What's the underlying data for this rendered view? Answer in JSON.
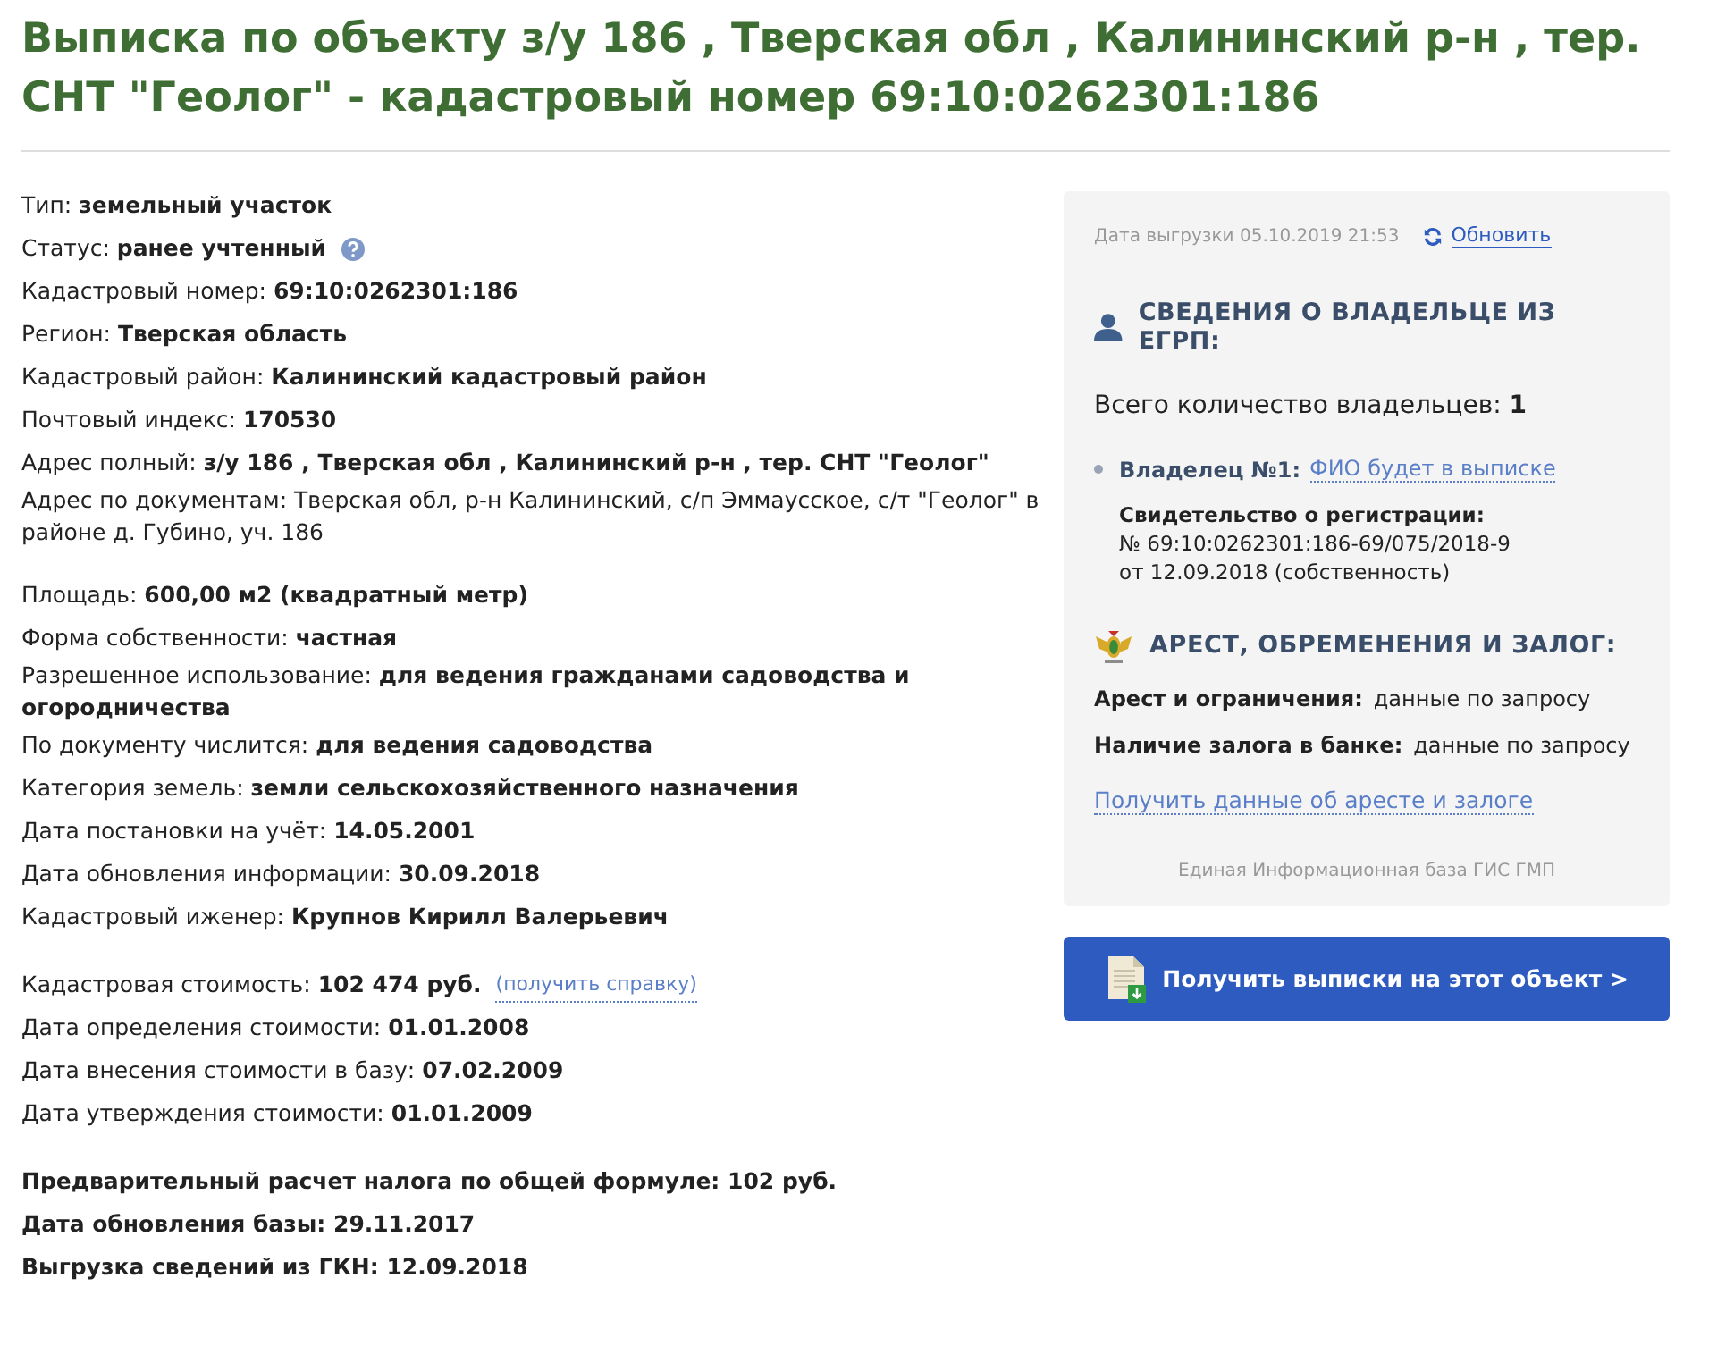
{
  "title": "Выписка по объекту з/у 186 , Тверская обл , Калининский р-н , тер. СНТ \"Геолог\" - кадастровый номер 69:10:0262301:186",
  "groups": [
    {
      "bold": false,
      "rows": [
        {
          "kind": "plain",
          "text": "Тип: **земельный участок**"
        },
        {
          "kind": "help",
          "text": "Статус: **ранее учтенный**"
        },
        {
          "kind": "plain",
          "text": "Кадастровый номер: **69:10:0262301:186**"
        },
        {
          "kind": "plain",
          "text": "Регион: **Тверская область**"
        },
        {
          "kind": "plain",
          "text": "Кадастровый район: **Калининский кадастровый район**"
        },
        {
          "kind": "plain",
          "text": "Почтовый индекс: **170530**"
        },
        {
          "kind": "plain",
          "text": "Адрес полный: **з/у 186 , Тверская обл , Калининский р-н , тер. СНТ \"Геолог\"**"
        },
        {
          "kind": "plain",
          "text": "Адрес по документам: Тверская обл, р-н Калининский, с/п Эммаусское, с/т \"Геолог\" в районе д. Губино, уч. 186"
        }
      ]
    },
    {
      "bold": false,
      "rows": [
        {
          "kind": "plain",
          "text": "Площадь: **600,00 м2 (квадратный метр)**"
        },
        {
          "kind": "plain",
          "text": "Форма собственности: **частная**"
        },
        {
          "kind": "plain",
          "text": "Разрешенное использование: **для ведения гражданами садоводства и огородничества**"
        },
        {
          "kind": "plain",
          "text": "По документу числится: **для ведения садоводства**"
        },
        {
          "kind": "plain",
          "text": "Категория земель: **земли сельскохозяйственного назначения**"
        },
        {
          "kind": "plain",
          "text": "Дата постановки на учёт: **14.05.2001**"
        },
        {
          "kind": "plain",
          "text": "Дата обновления информации: **30.09.2018**"
        },
        {
          "kind": "plain",
          "text": "Кадастровый иженер: **Крупнов Кирилл Валерьевич**"
        }
      ]
    },
    {
      "bold": false,
      "rows": [
        {
          "kind": "link",
          "text": "Кадастровая стоимость: **102 474 руб.**",
          "link": "(получить справку)"
        },
        {
          "kind": "plain",
          "text": "Дата определения стоимости: **01.01.2008**"
        },
        {
          "kind": "plain",
          "text": "Дата внесения стоимости в базу: **07.02.2009**"
        },
        {
          "kind": "plain",
          "text": "Дата утверждения стоимости: **01.01.2009**"
        }
      ]
    },
    {
      "bold": true,
      "rows": [
        {
          "kind": "plain",
          "text": "Предварительный расчет налога по общей формуле: 102 руб."
        },
        {
          "kind": "plain",
          "text": "Дата обновления базы: 29.11.2017"
        },
        {
          "kind": "plain",
          "text": "Выгрузка сведений из ГКН: 12.09.2018"
        }
      ]
    }
  ],
  "panel": {
    "export_date": "Дата выгрузки 05.10.2019 21:53",
    "refresh": "Обновить",
    "owner_heading": "СВЕДЕНИЯ О ВЛАДЕЛЬЦЕ ИЗ ЕГРП:",
    "owner_count": "Всего количество владельцев: **1**",
    "owners": [
      {
        "label": "Владелец №1:",
        "name": "ФИО будет в выписке",
        "cert_title": "Свидетельство о регистрации:",
        "cert_lines": [
          "№ 69:10:0262301:186-69/075/2018-9",
          "от 12.09.2018 (собственность)"
        ]
      }
    ],
    "arrest_heading": "АРЕСТ, ОБРЕМЕНЕНИЯ И ЗАЛОГ:",
    "arrest_rows": [
      {
        "label": "Арест и ограничения:",
        "value": "данные по запросу"
      },
      {
        "label": "Наличие залога в банке:",
        "value": "данные по запросу"
      }
    ],
    "arrest_link": "Получить данные об аресте и залоге",
    "footer": "Единая Информационная база ГИС ГМП"
  },
  "button": "Получить выписки на этот объект >"
}
